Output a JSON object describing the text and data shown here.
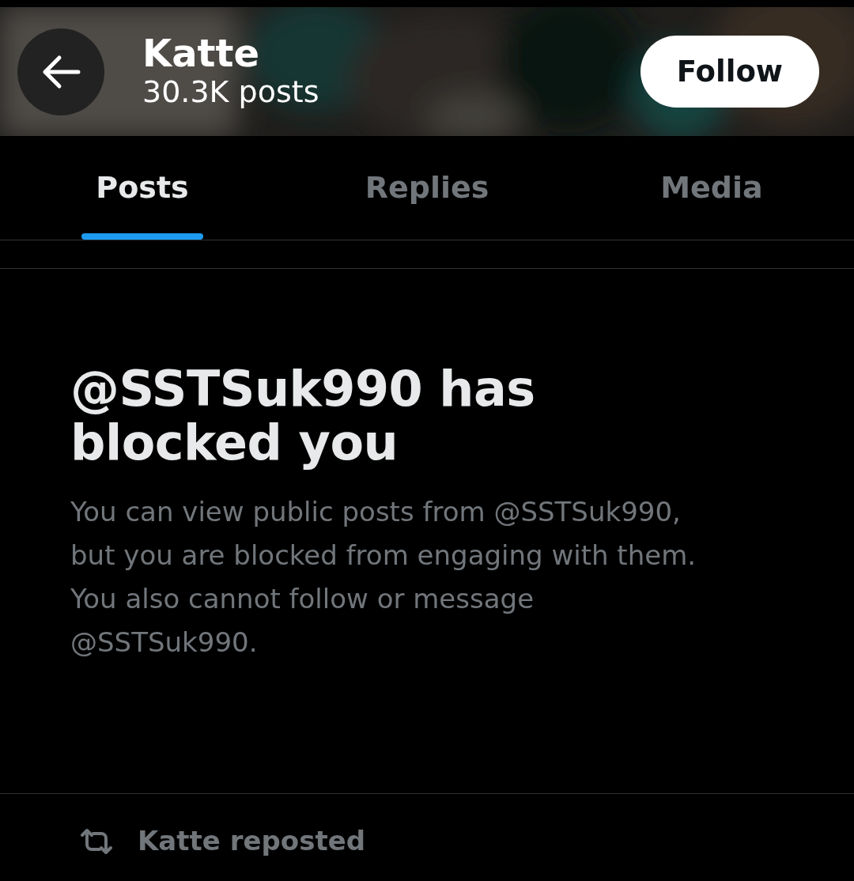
{
  "header": {
    "title": "Katte",
    "subtitle": "30.3K posts",
    "follow_button": "Follow"
  },
  "tabs": [
    {
      "label": "Posts",
      "selected": true
    },
    {
      "label": "Replies",
      "selected": false
    },
    {
      "label": "Media",
      "selected": false
    }
  ],
  "blocked_notice": {
    "heading": "@SSTSuk990 has blocked you",
    "body": "You can view public posts from @SSTSuk990, but you are blocked from engaging with them. You also cannot follow or message @SSTSuk990."
  },
  "repost": {
    "label": "Katte reposted"
  }
}
